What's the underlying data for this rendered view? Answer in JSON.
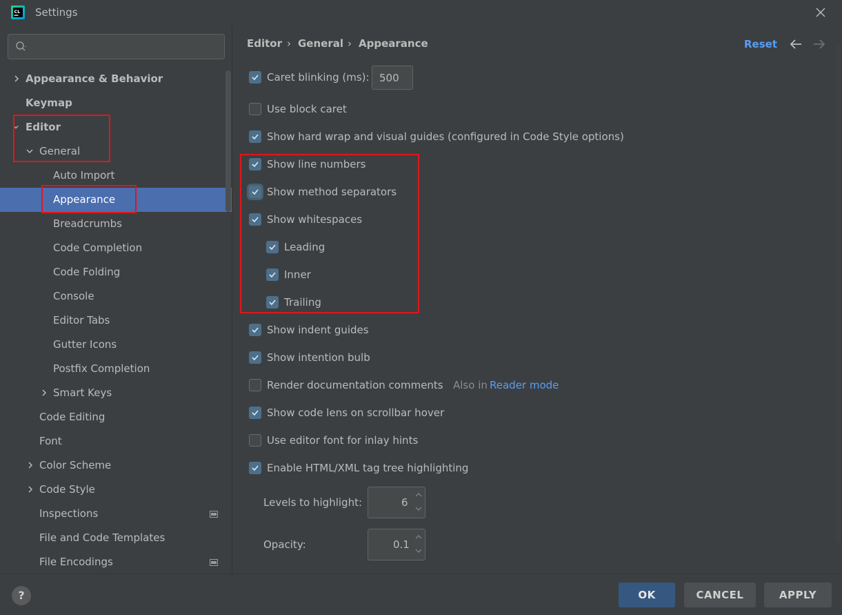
{
  "window": {
    "title": "Settings"
  },
  "search": {
    "placeholder": ""
  },
  "sidebar": {
    "items": [
      {
        "label": "Appearance & Behavior"
      },
      {
        "label": "Keymap"
      },
      {
        "label": "Editor"
      },
      {
        "label": "General"
      },
      {
        "label": "Auto Import"
      },
      {
        "label": "Appearance"
      },
      {
        "label": "Breadcrumbs"
      },
      {
        "label": "Code Completion"
      },
      {
        "label": "Code Folding"
      },
      {
        "label": "Console"
      },
      {
        "label": "Editor Tabs"
      },
      {
        "label": "Gutter Icons"
      },
      {
        "label": "Postfix Completion"
      },
      {
        "label": "Smart Keys"
      },
      {
        "label": "Code Editing"
      },
      {
        "label": "Font"
      },
      {
        "label": "Color Scheme"
      },
      {
        "label": "Code Style"
      },
      {
        "label": "Inspections"
      },
      {
        "label": "File and Code Templates"
      },
      {
        "label": "File Encodings"
      }
    ]
  },
  "breadcrumb": {
    "items": [
      "Editor",
      "General",
      "Appearance"
    ],
    "separator": "›"
  },
  "header": {
    "reset_label": "Reset"
  },
  "options": {
    "caret_blinking": {
      "label": "Caret blinking (ms):",
      "checked": true,
      "value": "500"
    },
    "block_caret": {
      "label": "Use block caret",
      "checked": false
    },
    "hard_wrap": {
      "label": "Show hard wrap and visual guides (configured in Code Style options)",
      "checked": true
    },
    "line_numbers": {
      "label": "Show line numbers",
      "checked": true
    },
    "method_separators": {
      "label": "Show method separators",
      "checked": true
    },
    "whitespaces": {
      "label": "Show whitespaces",
      "checked": true
    },
    "leading": {
      "label": "Leading",
      "checked": true
    },
    "inner": {
      "label": "Inner",
      "checked": true
    },
    "trailing": {
      "label": "Trailing",
      "checked": true
    },
    "indent_guides": {
      "label": "Show indent guides",
      "checked": true
    },
    "intention_bulb": {
      "label": "Show intention bulb",
      "checked": true
    },
    "render_docs": {
      "label": "Render documentation comments",
      "checked": false,
      "hint_prefix": "Also in",
      "hint_link": "Reader mode"
    },
    "code_lens": {
      "label": "Show code lens on scrollbar hover",
      "checked": true
    },
    "editor_font_inlay": {
      "label": "Use editor font for inlay hints",
      "checked": false
    },
    "tag_tree": {
      "label": "Enable HTML/XML tag tree highlighting",
      "checked": true
    },
    "levels": {
      "label": "Levels to highlight:",
      "value": "6"
    },
    "opacity": {
      "label": "Opacity:",
      "value": "0.1"
    }
  },
  "footer": {
    "help_label": "?",
    "ok_label": "OK",
    "cancel_label": "CANCEL",
    "apply_label": "APPLY"
  },
  "colors": {
    "accent": "#4b6eaf",
    "link": "#589df6",
    "highlight_box": "#e0161c",
    "background": "#3c3f41"
  }
}
